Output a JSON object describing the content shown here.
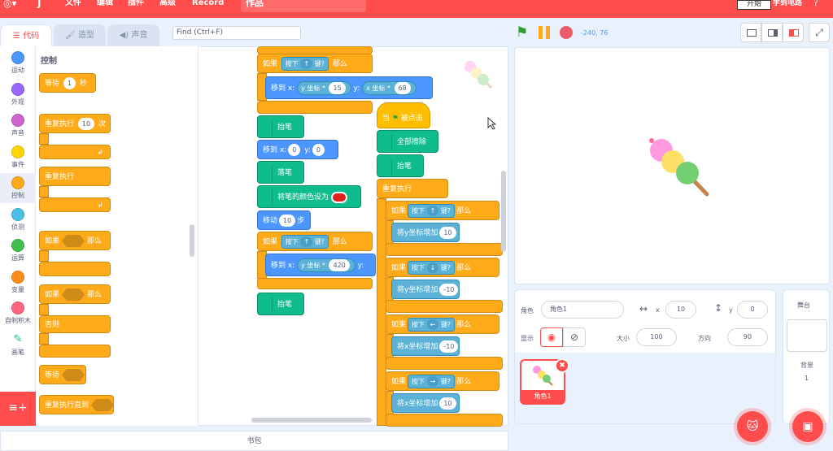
{
  "menubar": {
    "file": "文件",
    "edit": "编辑",
    "plugins": "插件",
    "advanced": "高级",
    "record": "Record",
    "project_title": "作品",
    "action_button": "开始",
    "right_label": "学到电路"
  },
  "tabs": {
    "code": "代码",
    "costumes": "造型",
    "sounds": "声音"
  },
  "search": {
    "placeholder": "Find (Ctrl+F)"
  },
  "categories": [
    {
      "label": "运动",
      "color": "#4c97ff"
    },
    {
      "label": "外观",
      "color": "#9966ff"
    },
    {
      "label": "声音",
      "color": "#cf63cf"
    },
    {
      "label": "事件",
      "color": "#ffd500"
    },
    {
      "label": "控制",
      "color": "#ffab19"
    },
    {
      "label": "侦测",
      "color": "#4cbfe6"
    },
    {
      "label": "运算",
      "color": "#40bf4a"
    },
    {
      "label": "变量",
      "color": "#ff8c1a"
    },
    {
      "label": "自制积木",
      "color": "#ff6680"
    },
    {
      "label": "画笔",
      "color": "#0fbd8c"
    }
  ],
  "palette": {
    "title": "控制",
    "wait": "等待",
    "wait_value": "1",
    "wait_unit": "秒",
    "repeat": "重复执行",
    "repeat_value": "10",
    "repeat_unit": "次",
    "forever": "重复执行",
    "if": "如果",
    "then": "那么",
    "else": "否则",
    "wait_until": "等待",
    "repeat_until": "重复执行直到"
  },
  "script1": {
    "if": "如果",
    "press": "按下",
    "key_up": "↑",
    "key": "键?",
    "then": "那么",
    "move_to_x": "移到 x:",
    "y_coord": "y 坐标",
    "times": "*",
    "val15": "15",
    "y_label": "y:",
    "x_coord": "x 坐标",
    "val68": "68",
    "pen_up": "抬笔",
    "move_to_x2": "移到 x:",
    "x0": "0",
    "y0": "0",
    "pen_down": "落笔",
    "set_pen_color": "将笔的颜色设为",
    "move": "移动",
    "steps_val": "10",
    "steps": "步",
    "val420": "420",
    "pen_up2": "抬笔"
  },
  "script2": {
    "when": "当",
    "clicked": "被点击",
    "clear": "全部擦除",
    "pen_up": "抬笔",
    "forever": "重复执行",
    "if": "如果",
    "press": "按下",
    "key": "键?",
    "then": "那么",
    "up": "↑",
    "down": "↓",
    "left": "←",
    "right": "→",
    "change_y": "将y坐标增加",
    "change_x": "将x坐标增加",
    "v10": "10",
    "vm10": "-10"
  },
  "stage_header": {
    "coords": "-240, 76"
  },
  "sprite_info": {
    "sprite_label": "角色",
    "sprite_name": "角色1",
    "x_label": "x",
    "x_value": "10",
    "y_label": "y",
    "y_value": "0",
    "show_label": "显示",
    "size_label": "大小",
    "size_value": "100",
    "direction_label": "方向",
    "direction_value": "90",
    "thumb_name": "角色1"
  },
  "stage_pane": {
    "title": "舞台",
    "backdrop_label": "背景",
    "backdrop_count": "1"
  },
  "backpack": {
    "label": "书包"
  },
  "colors": {
    "brand": "#ff4c4c",
    "pen_color": "#e0201a"
  }
}
